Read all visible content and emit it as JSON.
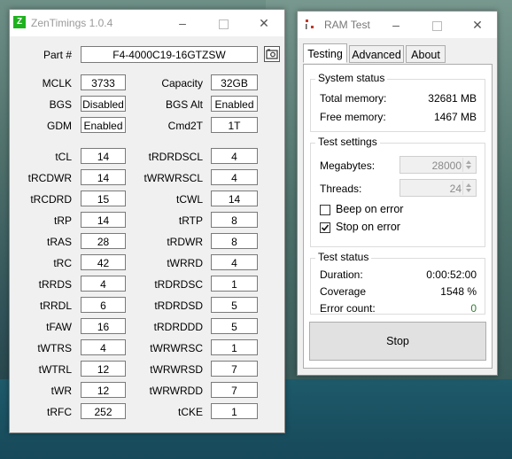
{
  "zentimings": {
    "title": "ZenTimings 1.0.4",
    "part_label": "Part #",
    "part_value": "F4-4000C19-16GTZSW",
    "info_left": [
      {
        "label": "MCLK",
        "value": "3733"
      },
      {
        "label": "BGS",
        "value": "Disabled"
      },
      {
        "label": "GDM",
        "value": "Enabled"
      }
    ],
    "info_right": [
      {
        "label": "Capacity",
        "value": "32GB"
      },
      {
        "label": "BGS Alt",
        "value": "Enabled"
      },
      {
        "label": "Cmd2T",
        "value": "1T"
      }
    ],
    "timings_left": [
      {
        "label": "tCL",
        "value": "14"
      },
      {
        "label": "tRCDWR",
        "value": "14"
      },
      {
        "label": "tRCDRD",
        "value": "15"
      },
      {
        "label": "tRP",
        "value": "14"
      },
      {
        "label": "tRAS",
        "value": "28"
      },
      {
        "label": "tRC",
        "value": "42"
      },
      {
        "label": "tRRDS",
        "value": "4"
      },
      {
        "label": "tRRDL",
        "value": "6"
      },
      {
        "label": "tFAW",
        "value": "16"
      },
      {
        "label": "tWTRS",
        "value": "4"
      },
      {
        "label": "tWTRL",
        "value": "12"
      },
      {
        "label": "tWR",
        "value": "12"
      },
      {
        "label": "tRFC",
        "value": "252"
      }
    ],
    "timings_right": [
      {
        "label": "tRDRDSCL",
        "value": "4"
      },
      {
        "label": "tWRWRSCL",
        "value": "4"
      },
      {
        "label": "tCWL",
        "value": "14"
      },
      {
        "label": "tRTP",
        "value": "8"
      },
      {
        "label": "tRDWR",
        "value": "8"
      },
      {
        "label": "tWRRD",
        "value": "4"
      },
      {
        "label": "tRDRDSC",
        "value": "1"
      },
      {
        "label": "tRDRDSD",
        "value": "5"
      },
      {
        "label": "tRDRDDD",
        "value": "5"
      },
      {
        "label": "tWRWRSC",
        "value": "1"
      },
      {
        "label": "tWRWRSD",
        "value": "7"
      },
      {
        "label": "tWRWRDD",
        "value": "7"
      },
      {
        "label": "tCKE",
        "value": "1"
      }
    ]
  },
  "ramtest": {
    "title": "RAM Test",
    "tabs": [
      "Testing",
      "Advanced",
      "About"
    ],
    "system_status": {
      "title": "System status",
      "total_label": "Total memory:",
      "total_value": "32681 MB",
      "free_label": "Free memory:",
      "free_value": "1467 MB"
    },
    "test_settings": {
      "title": "Test settings",
      "megabytes_label": "Megabytes:",
      "megabytes_value": "28000",
      "threads_label": "Threads:",
      "threads_value": "24",
      "beep_label": "Beep on error",
      "beep_checked": false,
      "stop_label": "Stop on error",
      "stop_checked": true
    },
    "test_status": {
      "title": "Test status",
      "duration_label": "Duration:",
      "duration_value": "0:00:52:00",
      "coverage_label": "Coverage",
      "coverage_value": "1548 %",
      "error_label": "Error count:",
      "error_value": "0"
    },
    "stop_button": "Stop",
    "error_color": "#2e7d32"
  },
  "icons": {
    "zt_app": "zentimings-logo-icon",
    "rt_app": "ramtest-logo-icon",
    "camera": "screenshot-camera-icon"
  },
  "colors": {
    "zt_logo_bg": "#1fb21f",
    "rt_logo": "#c0392b"
  }
}
